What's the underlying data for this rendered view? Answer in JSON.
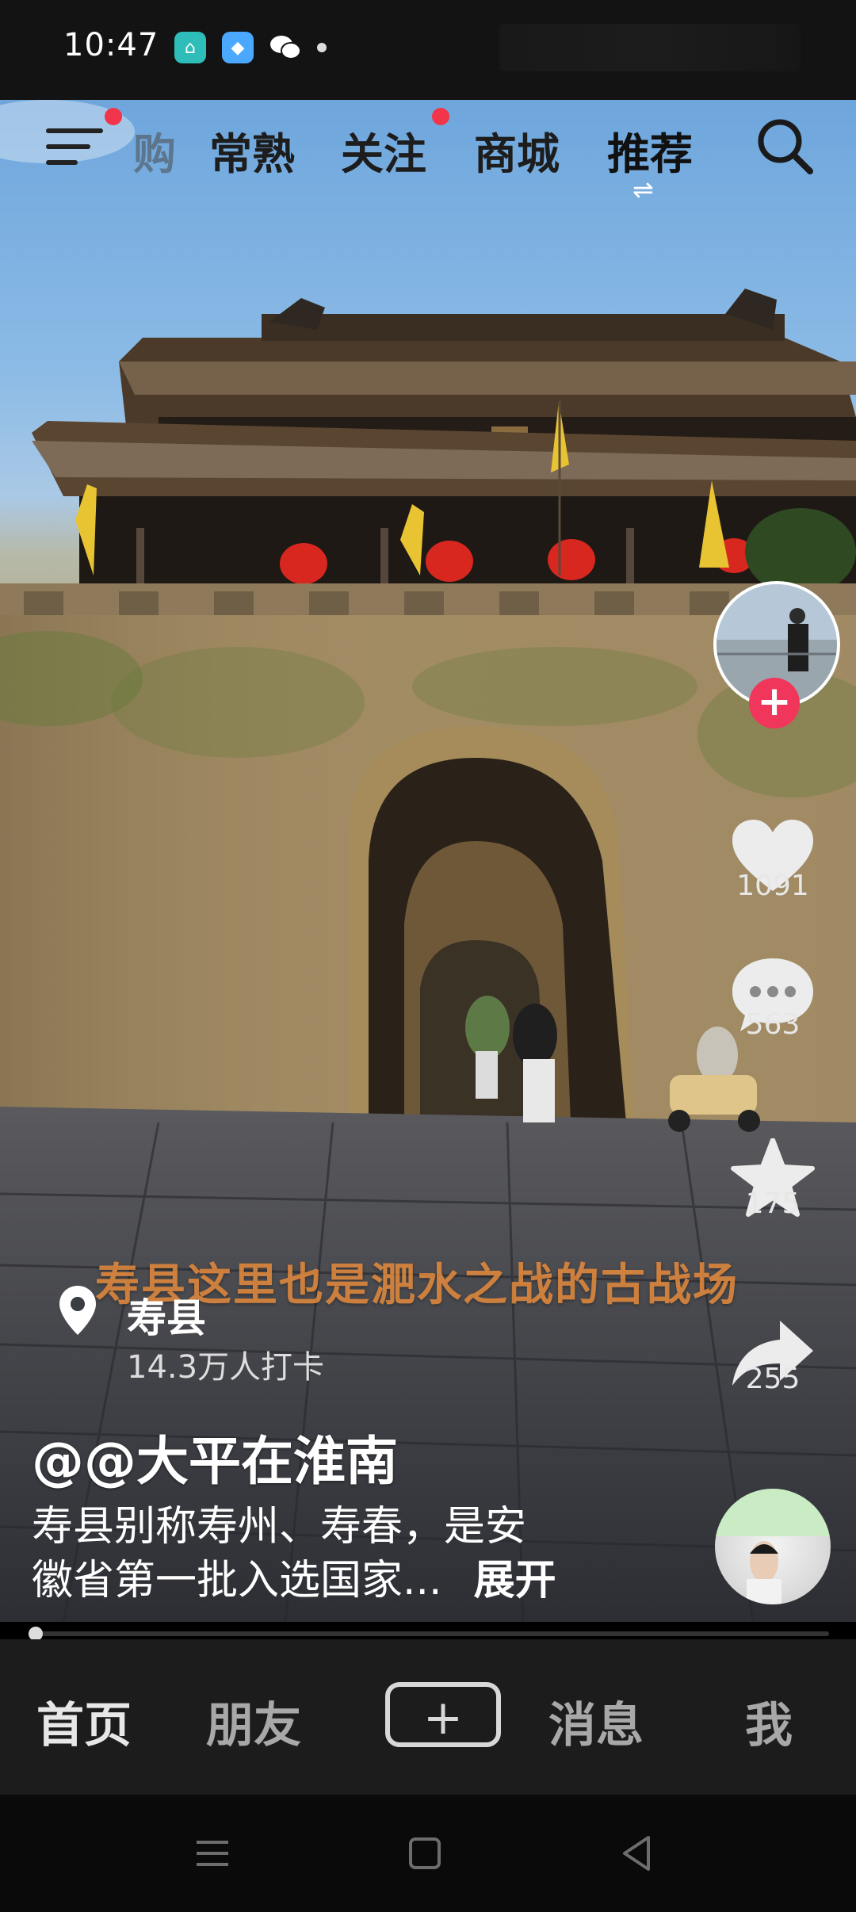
{
  "status_bar": {
    "time": "10:47",
    "icons": [
      "home-app-icon",
      "blue-app-icon",
      "wechat-icon",
      "dot-icon"
    ]
  },
  "top_nav": {
    "tabs": [
      {
        "label": "购",
        "state": "faded"
      },
      {
        "label": "常熟",
        "state": "normal"
      },
      {
        "label": "关注",
        "state": "normal",
        "has_dot": true
      },
      {
        "label": "商城",
        "state": "normal"
      },
      {
        "label": "推荐",
        "state": "active"
      }
    ],
    "menu_has_dot": true
  },
  "video": {
    "caption": "寿县这里也是淝水之战的古战场"
  },
  "side_actions": {
    "likes": "1091",
    "comments": "563",
    "favorites": "175",
    "shares": "255"
  },
  "location": {
    "name": "寿县",
    "checkins": "14.3万人打卡"
  },
  "post": {
    "author": "@@大平在淮南",
    "description_line1": "寿县别称寿州、寿春，是安",
    "description_line2": "徽省第一批入选国家...",
    "expand_label": "展开"
  },
  "playback_progress": 0.01,
  "bottom_nav": {
    "home": "首页",
    "friends": "朋友",
    "messages": "消息",
    "me": "我"
  },
  "colors": {
    "like_red": "#f0365a",
    "caption_orange": "#e58a3c",
    "nav_bg": "#1c1c1c"
  }
}
